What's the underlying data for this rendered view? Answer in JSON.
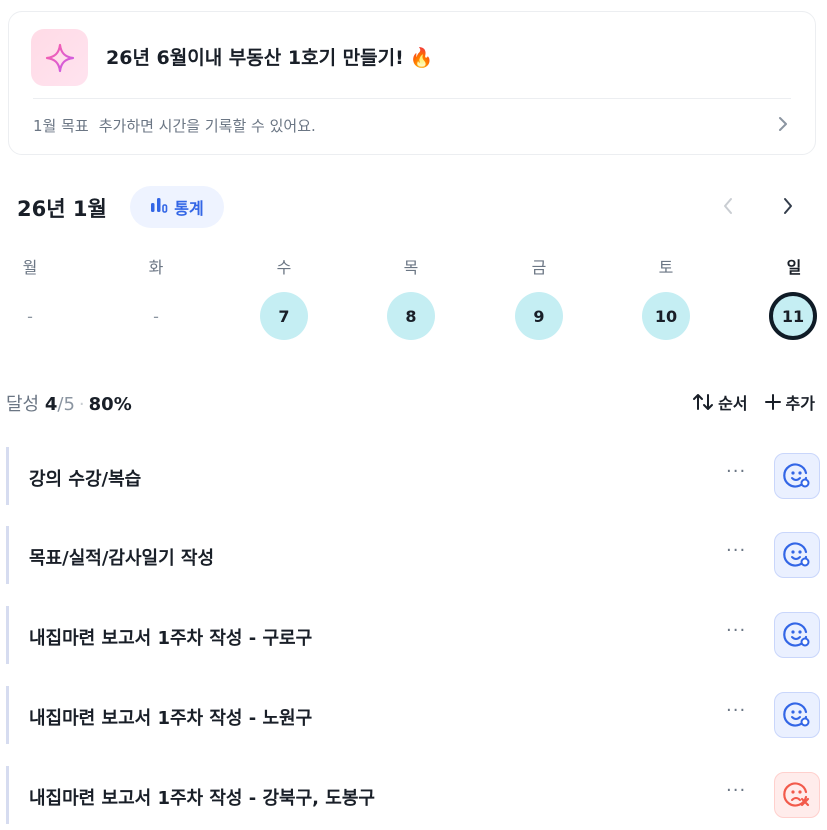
{
  "goal": {
    "title": "26년 6월이내 부동산 1호기 만들기!",
    "emoji": "🔥",
    "sub_month": "1월 목표",
    "sub_text": "추가하면 시간을 기록할 수 있어요.",
    "icon": "sparkle-icon"
  },
  "header": {
    "month": "26년 1월",
    "stats_label": "통계",
    "prev": "‹",
    "next": "›"
  },
  "week": {
    "days": [
      "월",
      "화",
      "수",
      "목",
      "금",
      "토",
      "일"
    ],
    "dates": [
      "-",
      "-",
      "7",
      "8",
      "9",
      "10",
      "11"
    ]
  },
  "summary": {
    "label": "달성",
    "done": "4",
    "total": "/5",
    "dot": "·",
    "percent": "80%",
    "sort_label": "순서",
    "add_label": "추가"
  },
  "tasks": [
    {
      "label": "강의 수강/복습",
      "more": "···",
      "status": "ok"
    },
    {
      "label": "목표/실적/감사일기 작성",
      "more": "···",
      "status": "ok"
    },
    {
      "label": "내집마련 보고서 1주차 작성 - 구로구",
      "more": "···",
      "status": "ok"
    },
    {
      "label": "내집마련 보고서 1주차 작성 - 노원구",
      "more": "···",
      "status": "ok"
    },
    {
      "label": "내집마련 보고서 1주차 작성 - 강북구, 도봉구",
      "more": "···",
      "status": "fail"
    }
  ],
  "colors": {
    "accent": "#3366e6",
    "day_fill": "#c5eef3",
    "today_ring": "#0f1b26",
    "fail": "#f25a4b"
  }
}
